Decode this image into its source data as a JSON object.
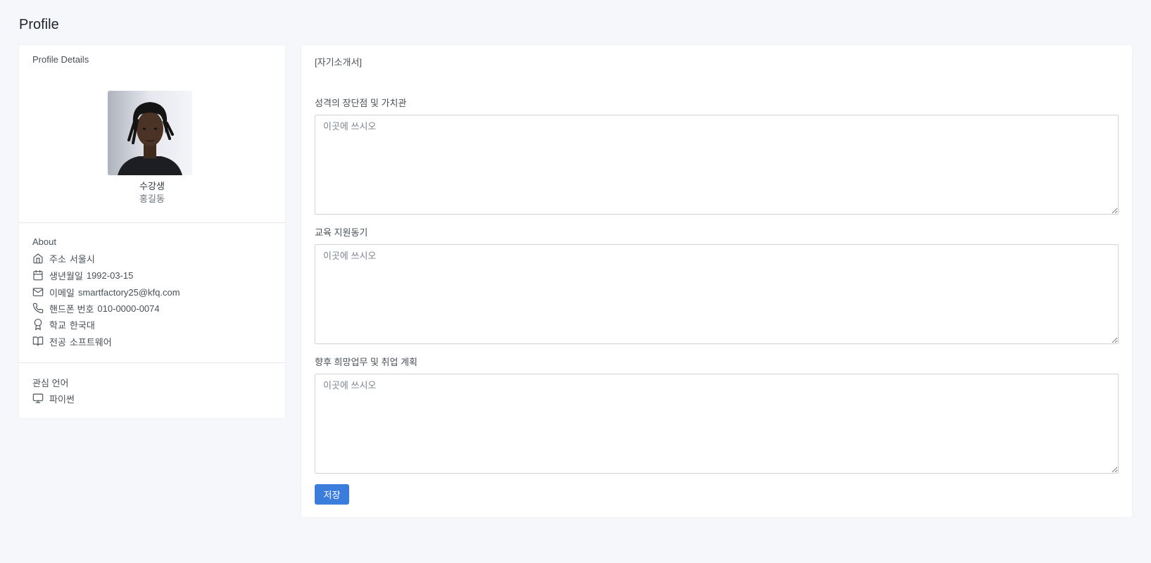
{
  "page": {
    "title": "Profile"
  },
  "profile": {
    "section_title": "Profile Details",
    "role": "수강생",
    "name": "홍길동"
  },
  "about": {
    "title": "About",
    "items": [
      {
        "icon": "home-icon",
        "label": "주소",
        "value": "서울시"
      },
      {
        "icon": "calendar-icon",
        "label": "생년월일",
        "value": "1992-03-15"
      },
      {
        "icon": "mail-icon",
        "label": "이메일",
        "value": "smartfactory25@kfq.com"
      },
      {
        "icon": "phone-icon",
        "label": "핸드폰 번호",
        "value": "010-0000-0074"
      },
      {
        "icon": "award-icon",
        "label": "학교",
        "value": "한국대"
      },
      {
        "icon": "book-icon",
        "label": "전공",
        "value": "소프트웨어"
      }
    ]
  },
  "interests": {
    "title": "관심 언어",
    "items": [
      {
        "icon": "monitor-icon",
        "value": "파이썬"
      }
    ]
  },
  "essay": {
    "header": "[자기소개서]",
    "questions": [
      {
        "label": "성격의 장단점 및 가치관",
        "placeholder": "이곳에 쓰시오",
        "value": ""
      },
      {
        "label": "교육 지원동기",
        "placeholder": "이곳에 쓰시오",
        "value": ""
      },
      {
        "label": "향후 희망업무 및 취업 계획",
        "placeholder": "이곳에 쓰시오",
        "value": ""
      }
    ],
    "save_label": "저장"
  },
  "colors": {
    "accent": "#3b7ddd",
    "background": "#f5f7fb",
    "card": "#ffffff"
  }
}
